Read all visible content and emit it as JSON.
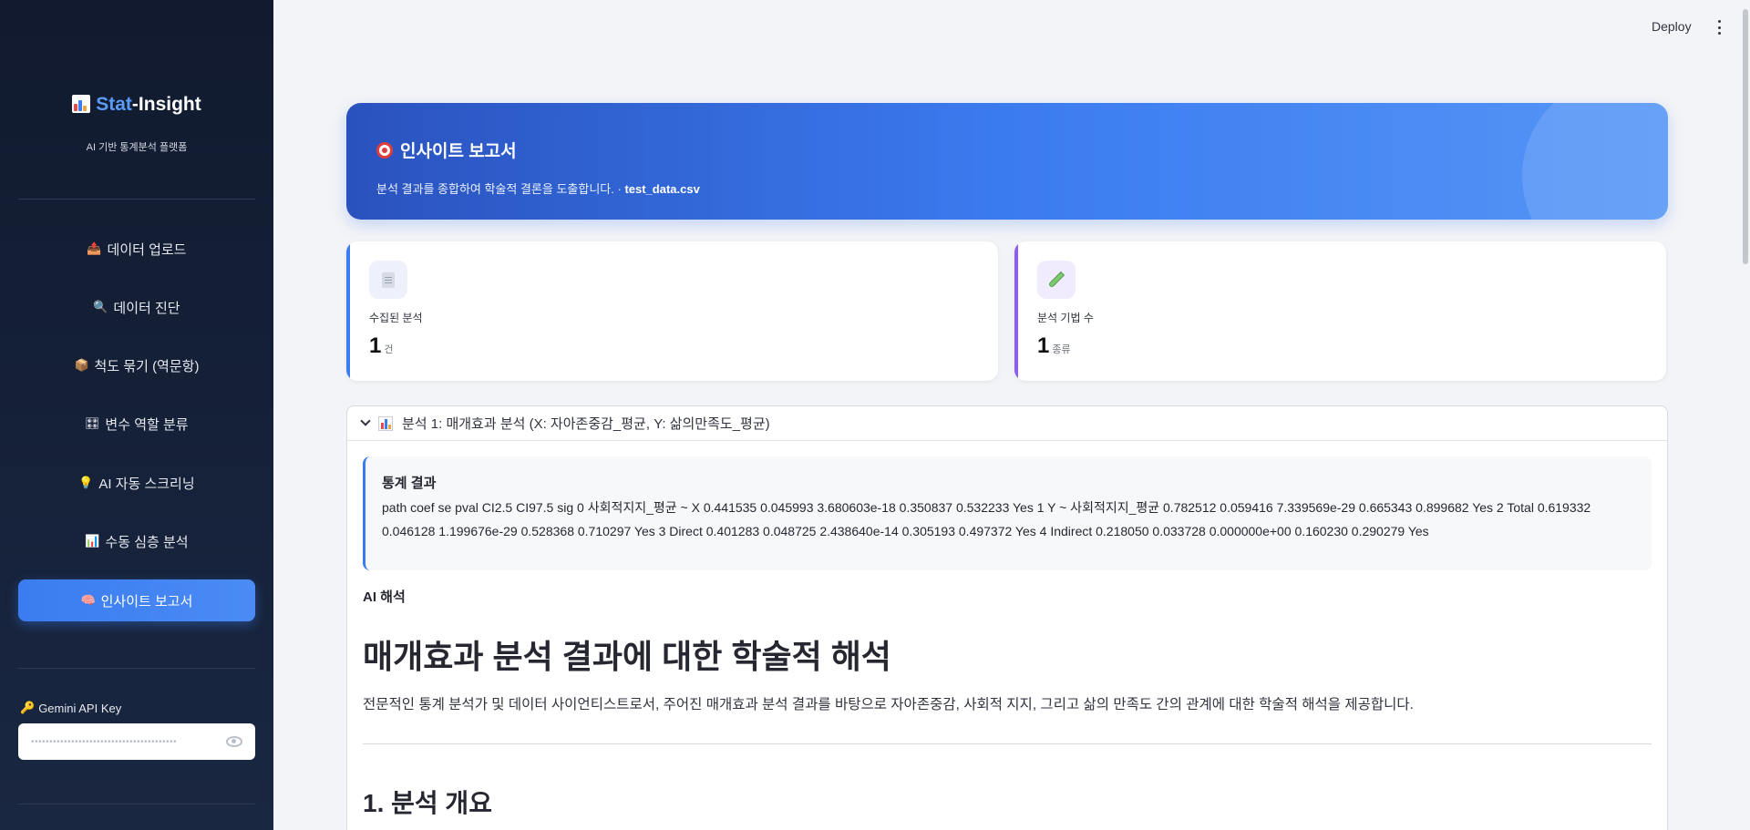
{
  "header": {
    "deploy_label": "Deploy",
    "menu_icon": "kebab-menu-icon"
  },
  "sidebar": {
    "logo_stat": "Stat",
    "logo_insight": "-Insight",
    "tagline": "AI 기반 통계분석 플랫폼",
    "items": [
      {
        "icon": "📤",
        "label": "데이터 업로드"
      },
      {
        "icon": "🔍",
        "label": "데이터 진단"
      },
      {
        "icon": "📦",
        "label": "척도 묶기 (역문항)"
      },
      {
        "icon": "🎛",
        "label": "변수 역할 분류"
      },
      {
        "icon": "💡",
        "label": "AI 자동 스크리닝"
      },
      {
        "icon": "📊",
        "label": "수동 심층 분석"
      },
      {
        "icon": "🧠",
        "label": "인사이트 보고서"
      }
    ],
    "active_index": 6,
    "api_label": "Gemini API Key",
    "api_value": "••••••••••••••••••••••••••••••••••••••••"
  },
  "banner": {
    "title": "인사이트 보고서",
    "subtitle": "분석 결과를 종합하여 학술적 결론을 도출합니다. · ",
    "filename": "test_data.csv"
  },
  "cards": [
    {
      "label": "수집된 분석",
      "value": "1",
      "unit": "건",
      "accent": "#3b7cf0"
    },
    {
      "label": "분석 기법 수",
      "value": "1",
      "unit": "종류",
      "accent": "#8b5cf6"
    }
  ],
  "expander": {
    "title": "분석 1: 매개효과 분석 (X: 자아존중감_평균, Y: 삶의만족도_평균)",
    "stats_title": "통계 결과",
    "stats_body": "path coef se pval CI2.5 CI97.5 sig 0 사회적지지_평균 ~ X 0.441535 0.045993 3.680603e-18 0.350837 0.532233 Yes 1 Y ~ 사회적지지_평균 0.782512 0.059416 7.339569e-29 0.665343 0.899682 Yes 2 Total 0.619332 0.046128 1.199676e-29 0.528368 0.710297 Yes 3 Direct 0.401283 0.048725 2.438640e-14 0.305193 0.497372 Yes 4 Indirect 0.218050 0.033728 0.000000e+00 0.160230 0.290279 Yes",
    "ai_label": "AI 해석",
    "heading": "매개효과 분석 결과에 대한 학술적 해석",
    "paragraph": "전문적인 통계 분석가 및 데이터 사이언티스트로서, 주어진 매개효과 분석 결과를 바탕으로 자아존중감, 사회적 지지, 그리고 삶의 만족도 간의 관계에 대한 학술적 해석을 제공합니다.",
    "section_heading": "1. 분석 개요"
  }
}
